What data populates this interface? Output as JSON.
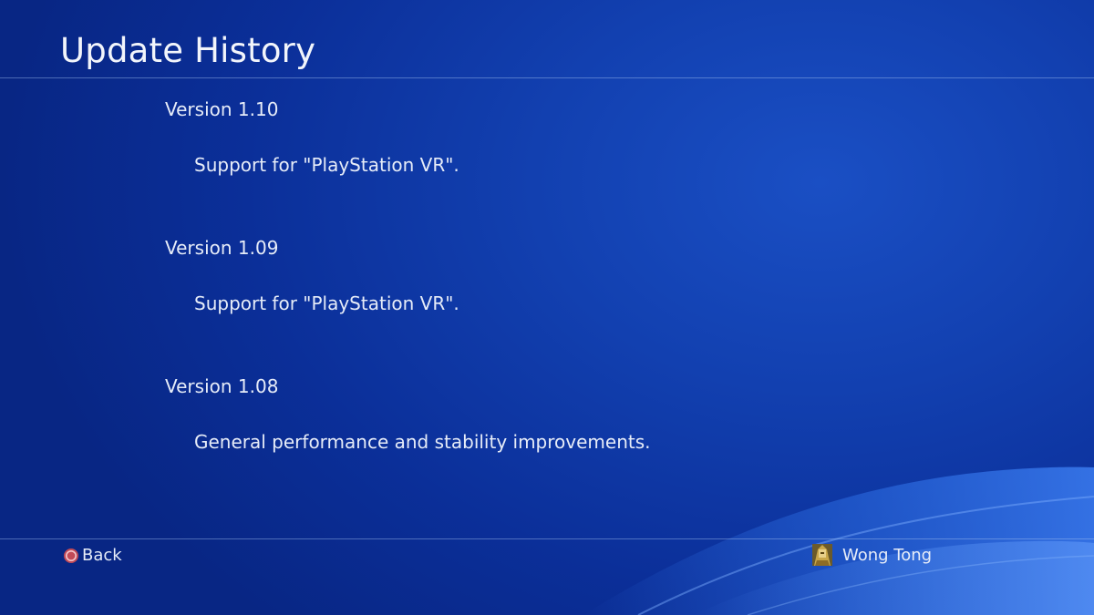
{
  "header": {
    "title": "Update History"
  },
  "history": [
    {
      "version": "Version 1.10",
      "note": "Support for \"PlayStation VR\"."
    },
    {
      "version": "Version 1.09",
      "note": "Support for \"PlayStation VR\"."
    },
    {
      "version": "Version 1.08",
      "note": "General performance and stability improvements."
    }
  ],
  "footer": {
    "back_label": "Back",
    "back_icon": "circle-button-icon",
    "user_name": "Wong Tong",
    "user_icon": "avatar"
  },
  "colors": {
    "background": "#0b2f99",
    "text": "#e6ecf8",
    "circle_button": "#e0707a"
  }
}
